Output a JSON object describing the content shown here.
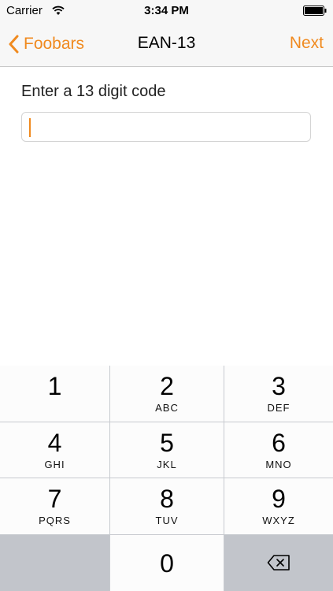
{
  "status_bar": {
    "carrier": "Carrier",
    "time": "3:34 PM"
  },
  "nav": {
    "back_label": "Foobars",
    "title": "EAN-13",
    "next_label": "Next"
  },
  "form": {
    "prompt": "Enter a 13 digit code",
    "value": ""
  },
  "keypad": {
    "keys": [
      {
        "num": "1",
        "letters": ""
      },
      {
        "num": "2",
        "letters": "ABC"
      },
      {
        "num": "3",
        "letters": "DEF"
      },
      {
        "num": "4",
        "letters": "GHI"
      },
      {
        "num": "5",
        "letters": "JKL"
      },
      {
        "num": "6",
        "letters": "MNO"
      },
      {
        "num": "7",
        "letters": "PQRS"
      },
      {
        "num": "8",
        "letters": "TUV"
      },
      {
        "num": "9",
        "letters": "WXYZ"
      },
      {
        "num": "0",
        "letters": ""
      }
    ]
  },
  "colors": {
    "accent": "#f08a1f",
    "bar_bg": "#f7f7f7",
    "keypad_bg": "#c7cacf"
  }
}
